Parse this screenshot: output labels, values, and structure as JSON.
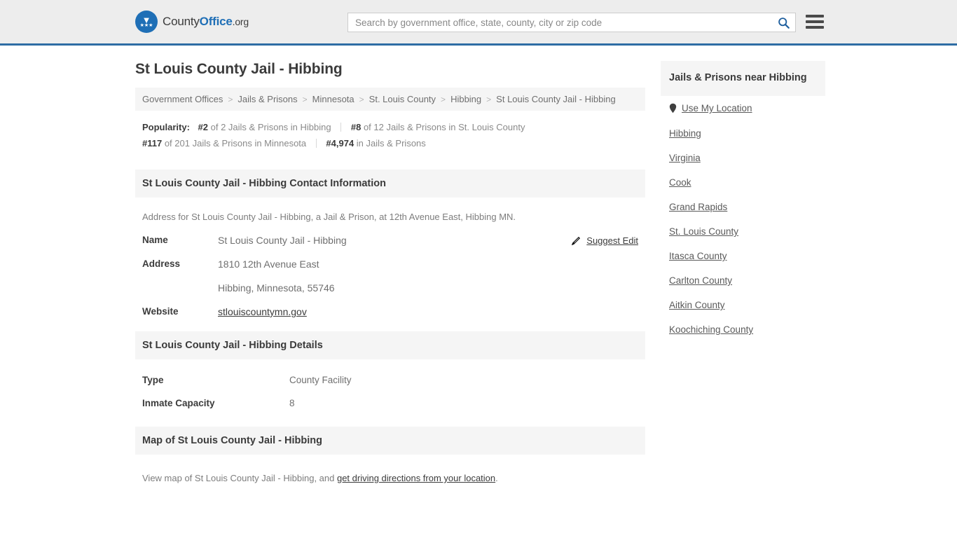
{
  "header": {
    "brand": {
      "part1": "County",
      "part2": "Office",
      "part3": ".org",
      "logo_icon": "eagle-shield-logo",
      "stars": "★★★",
      "eagle": "▼"
    },
    "search": {
      "placeholder": "Search by government office, state, county, city or zip code",
      "value": "",
      "search_icon": "search-icon"
    },
    "menu": {
      "icon": "hamburger-menu-icon"
    }
  },
  "main": {
    "title": "St Louis County Jail - Hibbing",
    "breadcrumb": {
      "separator": ">",
      "items": [
        "Government Offices",
        "Jails & Prisons",
        "Minnesota",
        "St. Louis County",
        "Hibbing",
        "St Louis County Jail - Hibbing"
      ]
    },
    "popularity": {
      "label": "Popularity:",
      "stats": [
        {
          "rank": "#2",
          "rest": "of 2 Jails & Prisons in Hibbing"
        },
        {
          "rank": "#8",
          "rest": "of 12 Jails & Prisons in St. Louis County"
        },
        {
          "rank": "#117",
          "rest": "of 201 Jails & Prisons in Minnesota"
        },
        {
          "rank": "#4,974",
          "rest": "in Jails & Prisons"
        }
      ]
    },
    "contact": {
      "heading": "St Louis County Jail - Hibbing Contact Information",
      "lead": "Address for St Louis County Jail - Hibbing, a Jail & Prison, at 12th Avenue East, Hibbing MN.",
      "suggest_edit": {
        "label": "Suggest Edit",
        "icon": "edit-pencil-icon"
      },
      "rows": [
        {
          "key": "Name",
          "value": "St Louis County Jail - Hibbing",
          "link": false
        },
        {
          "key": "Address",
          "value": "1810 12th Avenue East",
          "link": false
        },
        {
          "key": "",
          "value": "Hibbing, Minnesota, 55746",
          "link": false
        },
        {
          "key": "Website",
          "value": "stlouiscountymn.gov",
          "link": true
        }
      ]
    },
    "details": {
      "heading": "St Louis County Jail - Hibbing Details",
      "rows": [
        {
          "key": "Type",
          "value": "County Facility"
        },
        {
          "key": "Inmate Capacity",
          "value": "8"
        }
      ]
    },
    "map": {
      "heading": "Map of St Louis County Jail - Hibbing",
      "text_before": "View map of St Louis County Jail - Hibbing, and ",
      "link": "get driving directions from your location",
      "text_after": "."
    }
  },
  "rail": {
    "heading": "Jails & Prisons near Hibbing",
    "use_my_location": {
      "label": "Use My Location",
      "icon": "map-pin-icon"
    },
    "items": [
      "Hibbing",
      "Virginia",
      "Cook",
      "Grand Rapids",
      "St. Louis County",
      "Itasca County",
      "Carlton County",
      "Aitkin County",
      "Koochiching County"
    ]
  },
  "colors": {
    "accent": "#2e6da4",
    "brand_blue": "#1f6fb6",
    "panel_gray": "#f5f5f5",
    "header_gray": "#ededed"
  }
}
